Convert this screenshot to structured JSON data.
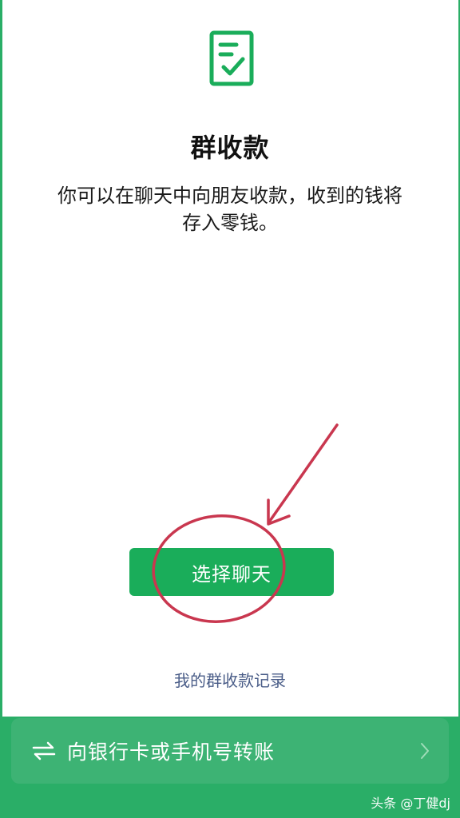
{
  "header": {
    "icon": "receipt-check-icon"
  },
  "main": {
    "title": "群收款",
    "description_line1": "你可以在聊天中向朋友收款，收到的钱将",
    "description_line2": "存入零钱。",
    "choose_chat_label": "选择聊天",
    "records_link_label": "我的群收款记录"
  },
  "bottom": {
    "transfer_label": "向银行卡或手机号转账",
    "transfer_icon": "swap-arrows-icon",
    "chevron_icon": "chevron-right-icon"
  },
  "watermark": {
    "text": "头条 @丁健dj"
  },
  "colors": {
    "brand_green": "#1aad5a",
    "bottom_green": "#2aae67",
    "link_blue": "#4a5d88",
    "annotation_red": "#c9374f"
  }
}
